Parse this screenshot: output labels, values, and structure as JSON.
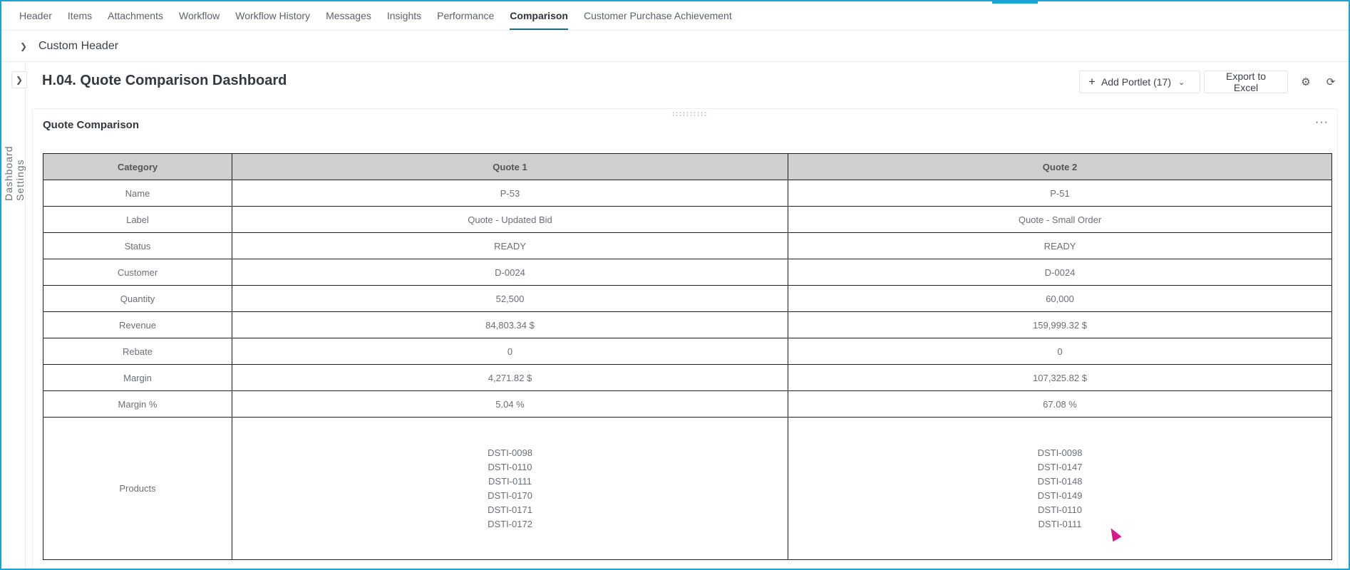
{
  "tabs": [
    {
      "label": "Header"
    },
    {
      "label": "Items"
    },
    {
      "label": "Attachments"
    },
    {
      "label": "Workflow"
    },
    {
      "label": "Workflow History"
    },
    {
      "label": "Messages"
    },
    {
      "label": "Insights"
    },
    {
      "label": "Performance"
    },
    {
      "label": "Comparison",
      "active": true
    },
    {
      "label": "Customer Purchase Achievement"
    }
  ],
  "custom_header": {
    "label": "Custom Header",
    "icon": "chevron-right-icon"
  },
  "sidebar": {
    "label": "Dashboard Settings",
    "toggle_icon": "chevron-right-icon"
  },
  "dashboard": {
    "title": "H.04. Quote Comparison Dashboard",
    "add_portlet_label": "Add Portlet (17)",
    "export_label": "Export to Excel"
  },
  "portlet": {
    "title": "Quote Comparison",
    "more_icon": "more-horizontal-icon",
    "table": {
      "headers": [
        "Category",
        "Quote 1",
        "Quote 2"
      ],
      "rows": [
        {
          "category": "Name",
          "q1": "P-53",
          "q2": "P-51"
        },
        {
          "category": "Label",
          "q1": "Quote - Updated Bid",
          "q2": "Quote - Small Order"
        },
        {
          "category": "Status",
          "q1": "READY",
          "q2": "READY"
        },
        {
          "category": "Customer",
          "q1": "D-0024",
          "q2": "D-0024"
        },
        {
          "category": "Quantity",
          "q1": "52,500",
          "q2": "60,000"
        },
        {
          "category": "Revenue",
          "q1": "84,803.34 $",
          "q2": "159,999.32 $"
        },
        {
          "category": "Rebate",
          "q1": "0",
          "q2": "0"
        },
        {
          "category": "Margin",
          "q1": "4,271.82 $",
          "q2": "107,325.82 $"
        },
        {
          "category": "Margin %",
          "q1": "5.04 %",
          "q2": "67.08 %"
        }
      ],
      "products": {
        "category": "Products",
        "q1": [
          "DSTI-0098",
          "DSTI-0110",
          "DSTI-0111",
          "DSTI-0170",
          "DSTI-0171",
          "DSTI-0172"
        ],
        "q2": [
          "DSTI-0098",
          "DSTI-0147",
          "DSTI-0148",
          "DSTI-0149",
          "DSTI-0110",
          "DSTI-0111"
        ]
      }
    }
  },
  "colors": {
    "accent": "#1c6e78",
    "frame": "#1aa3d4",
    "table_header_bg": "#cfcfcf",
    "cursor": "#d5198a"
  }
}
